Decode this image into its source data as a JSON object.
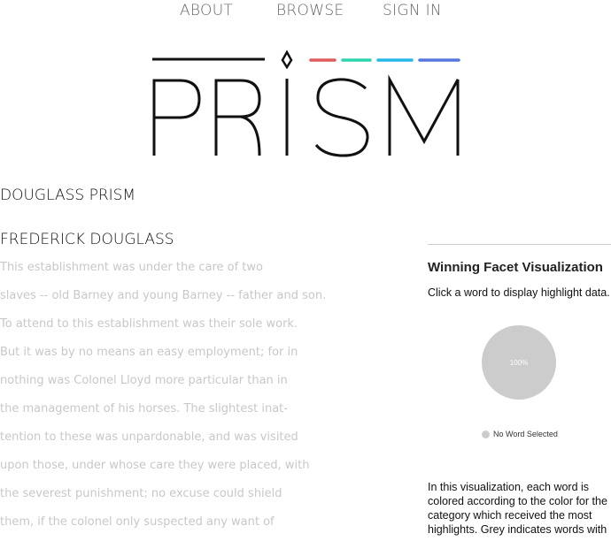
{
  "nav": {
    "about": "ABOUT",
    "browse": "BROWSE",
    "sign_in": "SIGN IN"
  },
  "logo": {
    "text": "PRISM",
    "bar_colors": [
      "#e05b5b",
      "#2ed3b0",
      "#26b8e6",
      "#5677e0"
    ],
    "ink_color": "#111111"
  },
  "page": {
    "title": "DOUGLASS PRISM",
    "author": "FREDERICK DOUGLASS"
  },
  "text_lines": [
    "   This establishment was under the care of two",
    "slaves -- old Barney and young Barney -- father and son.",
    "To attend to this establishment was their sole work.",
    "But it was by no means an easy employment; for in",
    "nothing was Colonel Lloyd more particular than in",
    "the management of his horses. The slightest inat-",
    "tention to these was unpardonable, and was visited",
    "upon those, under whose care they were placed, with",
    "the severest punishment; no excuse could shield",
    "them, if the colonel only suspected any want of"
  ],
  "panel": {
    "title": "Winning Facet Visualization",
    "hint": "Click a word to display highlight data.",
    "pie_label": "100%",
    "pie_color": "#cccccc",
    "legend_label": "No Word Selected",
    "description": "In this visualization, each word is colored according to the color for the category which received the most highlights. Grey indicates words with"
  }
}
